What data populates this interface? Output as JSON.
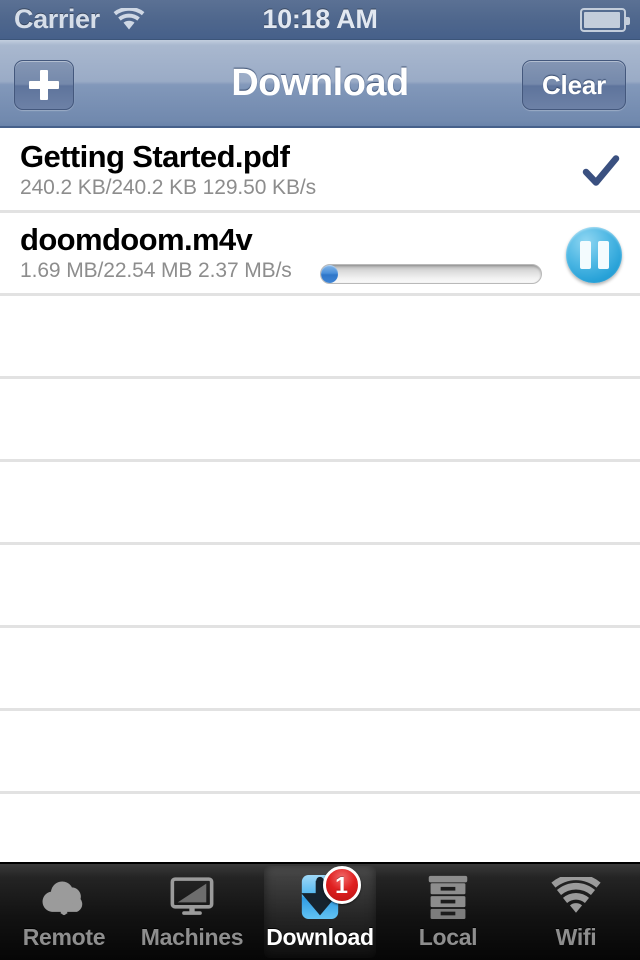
{
  "status_bar": {
    "carrier": "Carrier",
    "wifi_icon": "wifi-icon",
    "time": "10:18 AM",
    "battery_icon": "battery-icon"
  },
  "nav_bar": {
    "title": "Download",
    "add_button_label": "+",
    "add_icon": "plus-icon",
    "clear_button_label": "Clear"
  },
  "downloads": [
    {
      "name": "Getting Started.pdf",
      "detail": "240.2 KB/240.2 KB  129.50 KB/s",
      "downloaded": "240.2 KB",
      "total": "240.2 KB",
      "speed": "129.50 KB/s",
      "state": "complete",
      "accessory": "checkmark-icon",
      "progress_percent": 100,
      "show_progress_bar": false
    },
    {
      "name": "doomdoom.m4v",
      "detail": "1.69 MB/22.54 MB  2.37 MB/s",
      "downloaded": "1.69 MB",
      "total": "22.54 MB",
      "speed": "2.37 MB/s",
      "state": "downloading",
      "accessory": "pause-icon",
      "progress_percent": 7.5,
      "show_progress_bar": true
    }
  ],
  "empty_row_count": 7,
  "tab_bar": {
    "tabs": [
      {
        "label": "Remote",
        "icon": "cloud-upload-icon",
        "selected": false,
        "badge": null
      },
      {
        "label": "Machines",
        "icon": "monitor-icon",
        "selected": false,
        "badge": null
      },
      {
        "label": "Download",
        "icon": "download-arrow-icon",
        "selected": true,
        "badge": "1"
      },
      {
        "label": "Local",
        "icon": "file-cabinet-icon",
        "selected": false,
        "badge": null
      },
      {
        "label": "Wifi",
        "icon": "wifi-icon",
        "selected": false,
        "badge": null
      }
    ]
  },
  "colors": {
    "nav_bar_top": "#c3cede",
    "nav_bar_bottom": "#6a83aa",
    "status_bar": "#4f678d",
    "checkmark": "#3a5080",
    "progress_fill": "#3f85d4",
    "pause_button": "#28a2d8",
    "badge_red": "#e02020",
    "tab_bar": "#121212",
    "detail_text": "#8d8d8d",
    "separator": "#e2e2e2"
  }
}
